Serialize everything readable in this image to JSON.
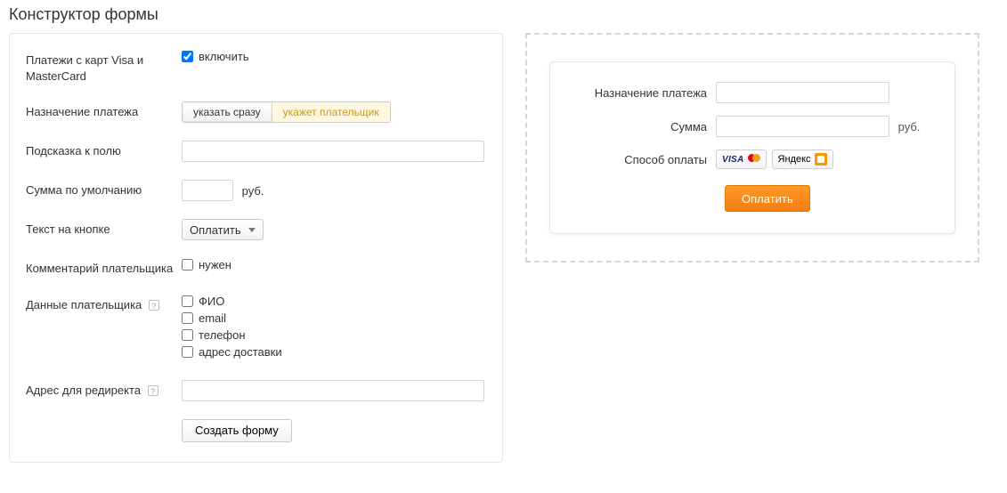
{
  "title": "Конструктор формы",
  "left": {
    "cards": {
      "label": "Платежи с карт Visa и MasterCard",
      "checkbox_label": "включить"
    },
    "purpose": {
      "label": "Назначение платежа",
      "option_now": "указать сразу",
      "option_payer": "укажет плательщик"
    },
    "hint": {
      "label": "Подсказка к полю",
      "value": ""
    },
    "default_amount": {
      "label": "Сумма по умолчанию",
      "value": "",
      "unit": "руб."
    },
    "button_text": {
      "label": "Текст на кнопке",
      "value": "Оплатить"
    },
    "comment": {
      "label": "Комментарий плательщика",
      "checkbox_label": "нужен"
    },
    "payer_data": {
      "label": "Данные плательщика",
      "fio": "ФИО",
      "email": "email",
      "phone": "телефон",
      "address": "адрес доставки"
    },
    "redirect": {
      "label": "Адрес для редиректа",
      "value": ""
    },
    "submit": "Создать форму",
    "help_glyph": "?"
  },
  "preview": {
    "purpose_label": "Назначение платежа",
    "purpose_value": "",
    "amount_label": "Сумма",
    "amount_value": "",
    "amount_unit": "руб.",
    "method_label": "Способ оплаты",
    "visa": "VISA",
    "yandex": "Яндекс",
    "pay_button": "Оплатить"
  }
}
